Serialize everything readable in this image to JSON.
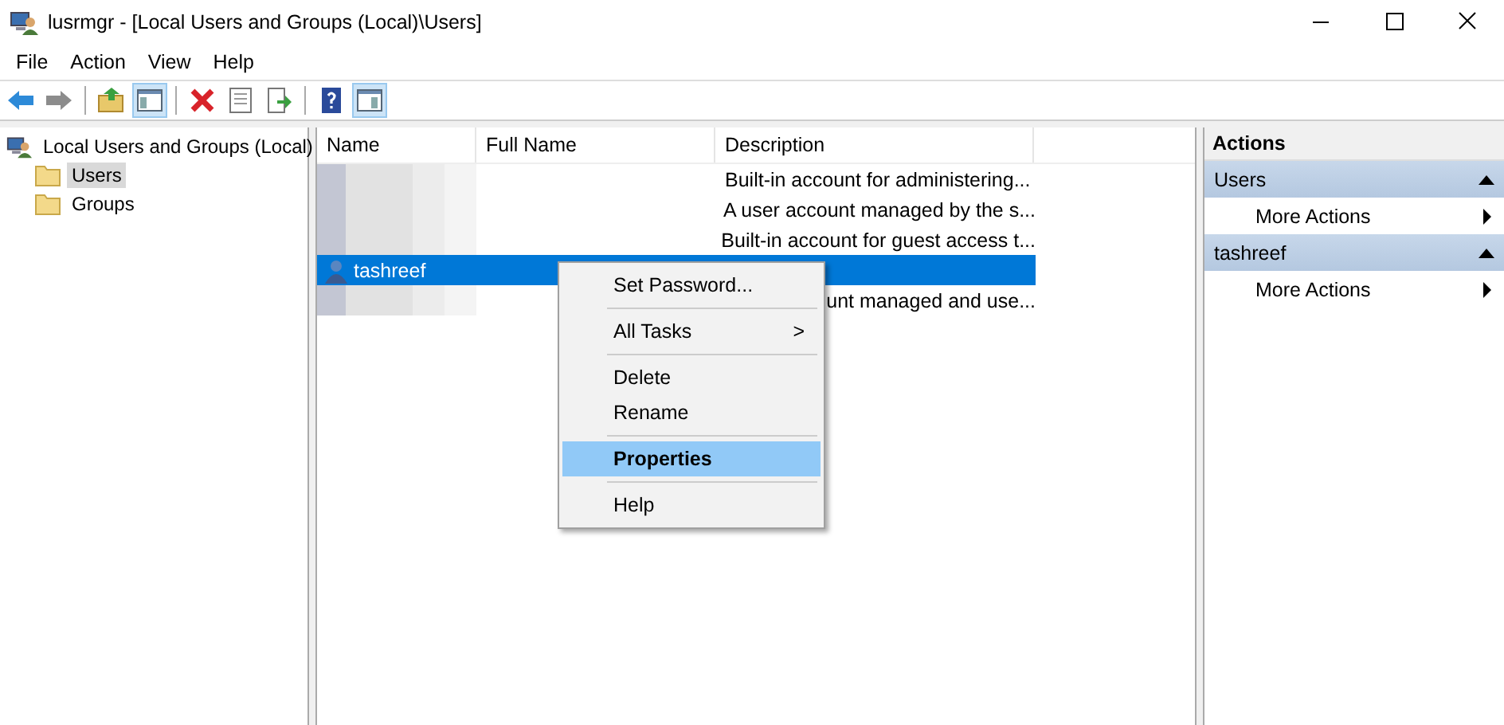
{
  "window": {
    "title": "lusrmgr - [Local Users and Groups (Local)\\Users]"
  },
  "menu": [
    "File",
    "Action",
    "View",
    "Help"
  ],
  "toolbar": [
    {
      "kind": "back",
      "pressed": false
    },
    {
      "kind": "forward",
      "pressed": false
    },
    {
      "kind": "separator"
    },
    {
      "kind": "up",
      "pressed": false
    },
    {
      "kind": "tree",
      "pressed": true
    },
    {
      "kind": "separator"
    },
    {
      "kind": "delete",
      "pressed": false
    },
    {
      "kind": "properties",
      "pressed": false
    },
    {
      "kind": "export",
      "pressed": false
    },
    {
      "kind": "separator"
    },
    {
      "kind": "help",
      "pressed": false
    },
    {
      "kind": "pane",
      "pressed": true
    }
  ],
  "tree": {
    "label": "Local Users and Groups (Local)",
    "children": [
      {
        "label": "Users",
        "selected": true
      },
      {
        "label": "Groups",
        "selected": false
      }
    ]
  },
  "list": {
    "columns": [
      "Name",
      "Full Name",
      "Description"
    ],
    "rows": [
      {
        "kind": "redacted",
        "description": "Built-in account for administering...",
        "selected": false
      },
      {
        "kind": "redacted",
        "description": "A user account managed by the s...",
        "selected": false
      },
      {
        "kind": "redacted",
        "description": "Built-in account for guest access t...",
        "selected": false
      },
      {
        "kind": "user",
        "name": "tashreef",
        "selected": true
      },
      {
        "kind": "redacted",
        "description": "unt managed and use...",
        "selected": false
      }
    ]
  },
  "context_menu": [
    {
      "kind": "item",
      "label": "Set Password...",
      "selected": false,
      "default": false
    },
    {
      "kind": "separator"
    },
    {
      "kind": "submenu",
      "label": "All Tasks",
      "arrow": ">",
      "selected": false,
      "default": false
    },
    {
      "kind": "separator"
    },
    {
      "kind": "item",
      "label": "Delete",
      "selected": false,
      "default": false
    },
    {
      "kind": "item",
      "label": "Rename",
      "selected": false,
      "default": false
    },
    {
      "kind": "separator"
    },
    {
      "kind": "item",
      "label": "Properties",
      "selected": true,
      "default": true
    },
    {
      "kind": "separator"
    },
    {
      "kind": "item",
      "label": "Help",
      "selected": false,
      "default": false
    }
  ],
  "actions": {
    "title": "Actions",
    "sections": [
      {
        "title": "Users",
        "items": [
          "More Actions"
        ]
      },
      {
        "title": "tashreef",
        "items": [
          "More Actions"
        ]
      }
    ]
  }
}
